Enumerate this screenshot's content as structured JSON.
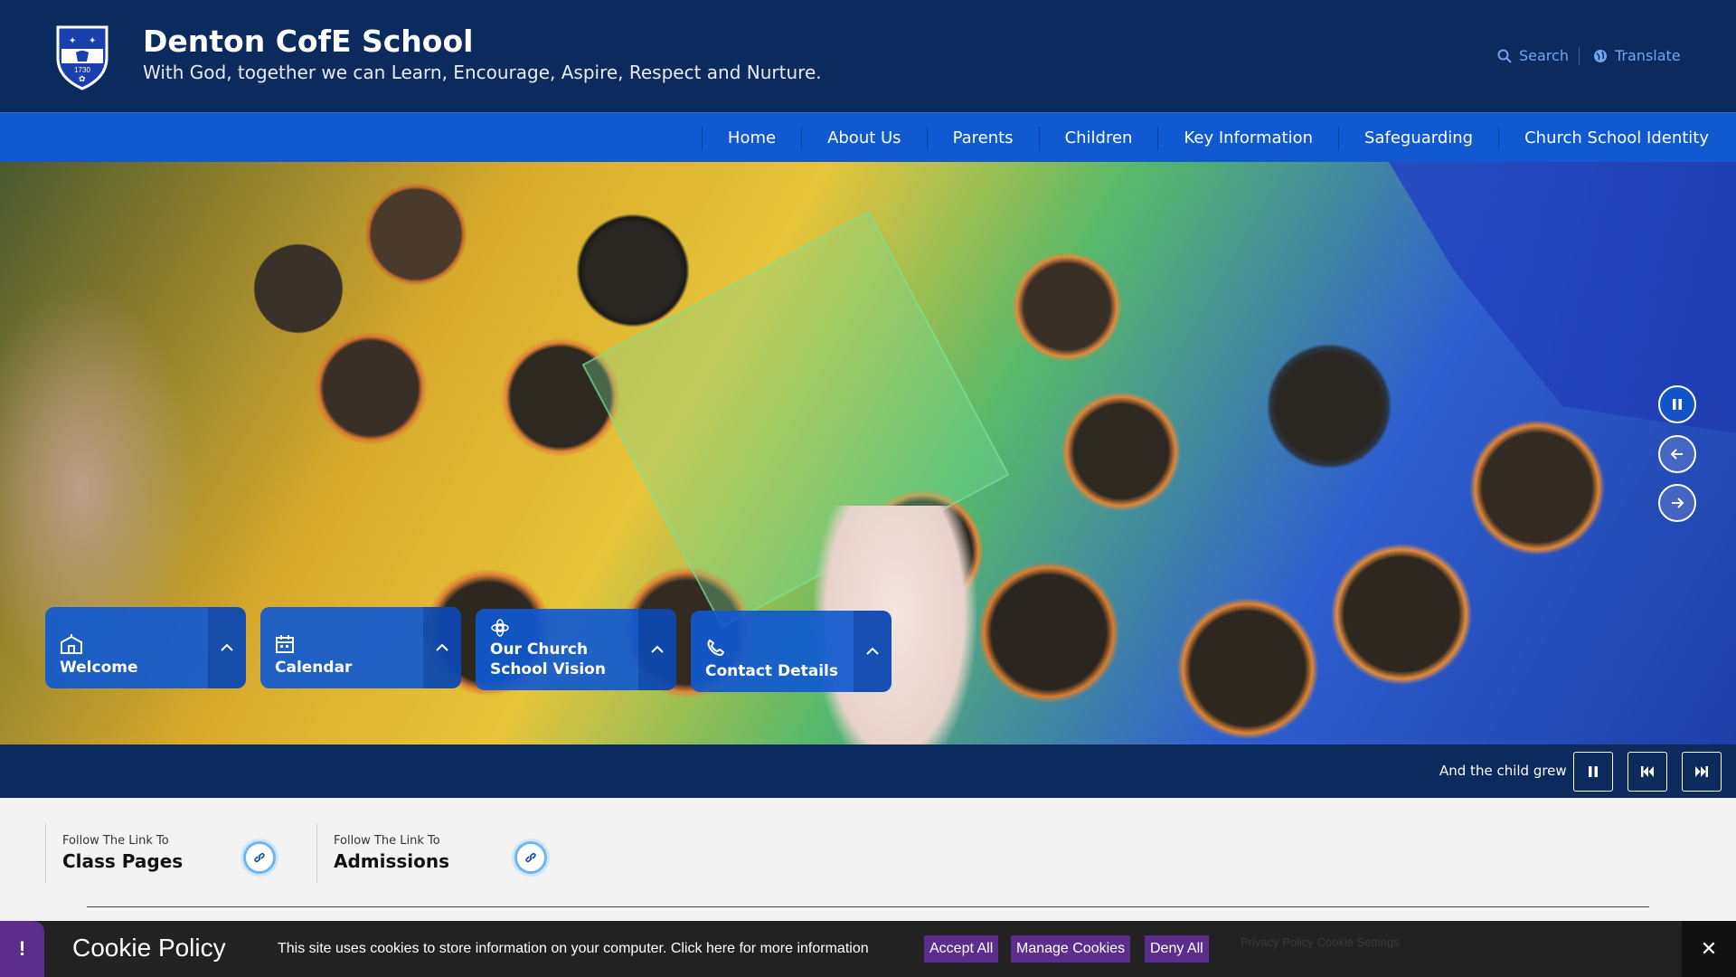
{
  "header": {
    "school_name": "Denton CofE School",
    "tagline": "With God, together we can Learn, Encourage, Aspire, Respect and Nurture.",
    "crest_year": "1730",
    "search_label": "Search",
    "translate_label": "Translate"
  },
  "nav": {
    "items": [
      "Home",
      "About Us",
      "Parents",
      "Children",
      "Key Information",
      "Safeguarding",
      "Church School Identity"
    ]
  },
  "hero": {
    "tiles": [
      {
        "label": "Welcome",
        "icon": "school-building-icon"
      },
      {
        "label": "Calendar",
        "icon": "calendar-icon"
      },
      {
        "label": "Our Church School Vision",
        "icon": "vision-flower-icon"
      },
      {
        "label": "Contact Details",
        "icon": "phone-icon"
      }
    ],
    "slider_controls": [
      "pause-icon",
      "arrow-left-icon",
      "arrow-right-icon"
    ]
  },
  "caption": {
    "text": "And the child grew"
  },
  "quick_links": [
    {
      "small": "Follow The Link To",
      "big": "Class Pages"
    },
    {
      "small": "Follow The Link To",
      "big": "Admissions"
    }
  ],
  "cookie": {
    "title": "Cookie Policy",
    "text": "This site uses cookies to store information on your computer. Click here for more information",
    "accept": "Accept All",
    "manage": "Manage Cookies",
    "deny": "Deny All",
    "faint_links": "Privacy Policy  Cookie Settings",
    "alert_symbol": "!",
    "close_symbol": "✕"
  },
  "colors": {
    "header_bg": "#0b2a5e",
    "nav_bg": "#1059d0",
    "cookie_accent": "#5b2d8c"
  }
}
